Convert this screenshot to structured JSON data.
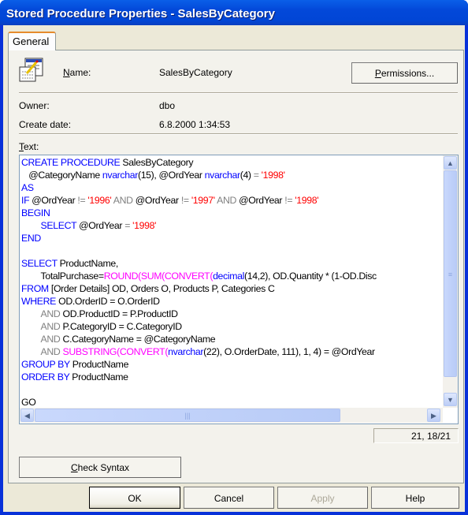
{
  "window": {
    "title": "Stored Procedure Properties - SalesByCategory"
  },
  "tabs": [
    {
      "label": "General",
      "active": true
    }
  ],
  "icon": "stored-procedure-icon",
  "fields": {
    "name_label": "Name:",
    "name_value": "SalesByCategory",
    "owner_label": "Owner:",
    "owner_value": "dbo",
    "create_date_label": "Create date:",
    "create_date_value": "6.8.2000 1:34:53",
    "text_label": "Text:"
  },
  "permissions_button": "Permissions...",
  "code_colors": {
    "keyword": "#0000ff",
    "operator": "#808080",
    "string": "#ff0000",
    "function": "#ff00ff",
    "identifier": "#000000"
  },
  "code_lines": [
    [
      [
        "CREATE PROCEDURE",
        "kw"
      ],
      [
        " SalesByCategory",
        "id"
      ]
    ],
    [
      [
        "   @CategoryName ",
        "id"
      ],
      [
        "nvarchar",
        "kw"
      ],
      [
        "(15), @OrdYear ",
        "id"
      ],
      [
        "nvarchar",
        "kw"
      ],
      [
        "(4) ",
        "id"
      ],
      [
        "=",
        "op"
      ],
      [
        " ",
        "id"
      ],
      [
        "'1998'",
        "str"
      ]
    ],
    [
      [
        "AS",
        "kw"
      ]
    ],
    [
      [
        "IF",
        "kw"
      ],
      [
        " @OrdYear ",
        "id"
      ],
      [
        "!=",
        "op"
      ],
      [
        " ",
        "id"
      ],
      [
        "'1996'",
        "str"
      ],
      [
        " AND ",
        "op"
      ],
      [
        "@OrdYear ",
        "id"
      ],
      [
        "!=",
        "op"
      ],
      [
        " ",
        "id"
      ],
      [
        "'1997'",
        "str"
      ],
      [
        " AND ",
        "op"
      ],
      [
        "@OrdYear ",
        "id"
      ],
      [
        "!=",
        "op"
      ],
      [
        " ",
        "id"
      ],
      [
        "'1998'",
        "str"
      ]
    ],
    [
      [
        "BEGIN",
        "kw"
      ]
    ],
    [
      [
        "\t",
        "id"
      ],
      [
        "SELECT",
        "kw"
      ],
      [
        " @OrdYear ",
        "id"
      ],
      [
        "=",
        "op"
      ],
      [
        " ",
        "id"
      ],
      [
        "'1998'",
        "str"
      ]
    ],
    [
      [
        "END",
        "kw"
      ]
    ],
    [
      [
        "",
        "id"
      ]
    ],
    [
      [
        "SELECT",
        "kw"
      ],
      [
        " ProductName,",
        "id"
      ]
    ],
    [
      [
        "\tTotalPurchase=",
        "id"
      ],
      [
        "ROUND(SUM(CONVERT(",
        "fn"
      ],
      [
        "decimal",
        "kw"
      ],
      [
        "(14,2), OD.Quantity * (1-OD.Disc",
        "id"
      ]
    ],
    [
      [
        "FROM",
        "kw"
      ],
      [
        " [Order Details] OD, Orders O, Products P, Categories C",
        "id"
      ]
    ],
    [
      [
        "WHERE",
        "kw"
      ],
      [
        " OD.OrderID = O.OrderID",
        "id"
      ]
    ],
    [
      [
        "\t",
        "id"
      ],
      [
        "AND",
        "op"
      ],
      [
        " OD.ProductID = P.ProductID",
        "id"
      ]
    ],
    [
      [
        "\t",
        "id"
      ],
      [
        "AND",
        "op"
      ],
      [
        " P.CategoryID = C.CategoryID",
        "id"
      ]
    ],
    [
      [
        "\t",
        "id"
      ],
      [
        "AND",
        "op"
      ],
      [
        " C.CategoryName = @CategoryName",
        "id"
      ]
    ],
    [
      [
        "\t",
        "id"
      ],
      [
        "AND",
        "op"
      ],
      [
        " ",
        "id"
      ],
      [
        "SUBSTRING(CONVERT(",
        "fn"
      ],
      [
        "nvarchar",
        "kw"
      ],
      [
        "(22), O.OrderDate, 111), 1, 4) = @OrdYear",
        "id"
      ]
    ],
    [
      [
        "GROUP BY",
        "kw"
      ],
      [
        " ProductName",
        "id"
      ]
    ],
    [
      [
        "ORDER BY",
        "kw"
      ],
      [
        " ProductName",
        "id"
      ]
    ],
    [
      [
        "",
        "id"
      ]
    ],
    [
      [
        "GO",
        "id"
      ]
    ]
  ],
  "cursor_position": "21, 18/21",
  "check_syntax_button": "Check Syntax",
  "footer_buttons": {
    "ok": "OK",
    "cancel": "Cancel",
    "apply": "Apply",
    "help": "Help"
  }
}
